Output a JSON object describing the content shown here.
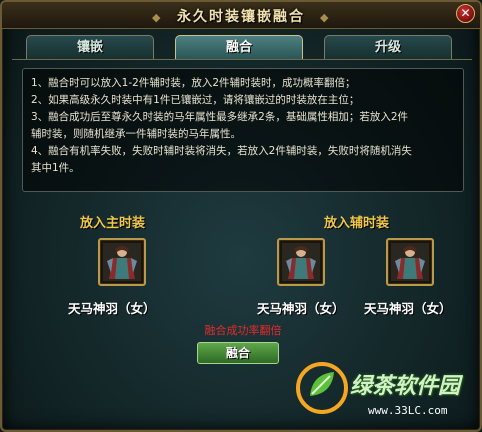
{
  "window": {
    "title": "永久时装镶嵌融合",
    "close_label": "✕"
  },
  "tabs": [
    {
      "label": "镶嵌",
      "active": false
    },
    {
      "label": "融合",
      "active": true
    },
    {
      "label": "升级",
      "active": false
    }
  ],
  "rules": [
    "1、融合时可以放入1-2件辅时装，放入2件辅时装时，成功概率翻倍；",
    "2、如果高级永久时装中有1件已镶嵌过，请将镶嵌过的时装放在主位；",
    "3、融合成功后至尊永久时装的马年属性最多继承2条，基础属性相加；若放入2件",
    "    辅时装，则随机继承一件辅时装的马年属性。",
    "4、融合有机率失败，失败时辅时装将消失，若放入2件辅时装，失败时将随机消失",
    "    其中1件。"
  ],
  "main_slot": {
    "header": "放入主时装",
    "item_name": "天马神羽（女）",
    "icon": "costume-figure-icon"
  },
  "aux_slots": {
    "header": "放入辅时装",
    "items": [
      {
        "item_name": "天马神羽（女）",
        "icon": "costume-figure-icon"
      },
      {
        "item_name": "天马神羽（女）",
        "icon": "costume-figure-icon"
      }
    ]
  },
  "success_text": "融合成功率翻倍",
  "fuse_button": "融合",
  "watermark": {
    "brand": "绿茶软件园",
    "url": "www.33LC.com"
  },
  "colors": {
    "title": "#f2e2b0",
    "header": "#f0c84b",
    "warning": "#e52b2b",
    "button": "#3f8a33"
  }
}
